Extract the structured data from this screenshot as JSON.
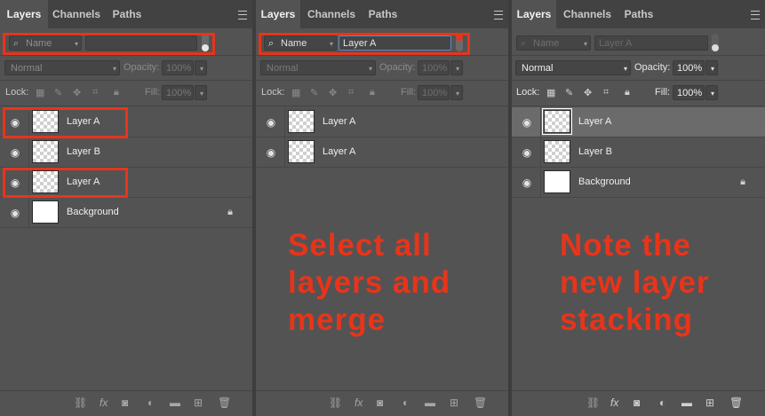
{
  "tabs": [
    "Layers",
    "Channels",
    "Paths"
  ],
  "filter_kind": "Name",
  "blend_mode": "Normal",
  "opacity_label": "Opacity:",
  "opacity_value": "100%",
  "lock_label": "Lock:",
  "fill_label": "Fill:",
  "fill_value": "100%",
  "panel1": {
    "filter_text": "",
    "layers": [
      "Layer A",
      "Layer B",
      "Layer A",
      "Background"
    ]
  },
  "panel2": {
    "filter_text": "Layer A",
    "layers": [
      "Layer A",
      "Layer A"
    ],
    "annotation": "Select all\nlayers and\nmerge"
  },
  "panel3": {
    "filter_text": "Layer A",
    "layers": [
      "Layer A",
      "Layer B",
      "Background"
    ],
    "annotation": "Note the\nnew layer\nstacking"
  },
  "colors": {
    "panel_bg": "#535353",
    "tab_bg": "#424242",
    "accent_red": "#e8341a",
    "selected_row": "#6b6b6b"
  },
  "icons": [
    "search-icon",
    "panel-menu-icon",
    "eye-icon",
    "lock-transparent-icon",
    "lock-paint-icon",
    "lock-move-icon",
    "lock-artboard-icon",
    "lock-all-icon",
    "padlock-icon",
    "link-icon",
    "fx-icon",
    "mask-icon",
    "adjustment-icon",
    "folder-icon",
    "new-layer-icon",
    "trash-icon"
  ]
}
